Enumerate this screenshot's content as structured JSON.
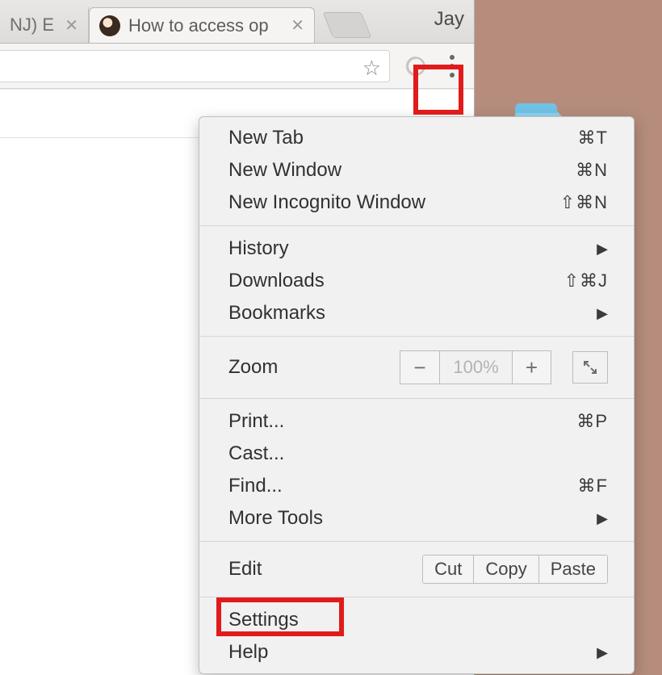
{
  "tabs": {
    "inactive_label": "NJ) E",
    "active_label": "How to access op"
  },
  "profile": {
    "name": "Jay"
  },
  "menu": {
    "new_tab": {
      "label": "New Tab",
      "accel": "⌘T"
    },
    "new_window": {
      "label": "New Window",
      "accel": "⌘N"
    },
    "new_incognito": {
      "label": "New Incognito Window",
      "accel": "⇧⌘N"
    },
    "history": {
      "label": "History"
    },
    "downloads": {
      "label": "Downloads",
      "accel": "⇧⌘J"
    },
    "bookmarks": {
      "label": "Bookmarks"
    },
    "zoom": {
      "label": "Zoom",
      "pct": "100%"
    },
    "print": {
      "label": "Print...",
      "accel": "⌘P"
    },
    "cast": {
      "label": "Cast..."
    },
    "find": {
      "label": "Find...",
      "accel": "⌘F"
    },
    "more_tools": {
      "label": "More Tools"
    },
    "edit": {
      "label": "Edit",
      "cut": "Cut",
      "copy": "Copy",
      "paste": "Paste"
    },
    "settings": {
      "label": "Settings"
    },
    "help": {
      "label": "Help"
    }
  }
}
